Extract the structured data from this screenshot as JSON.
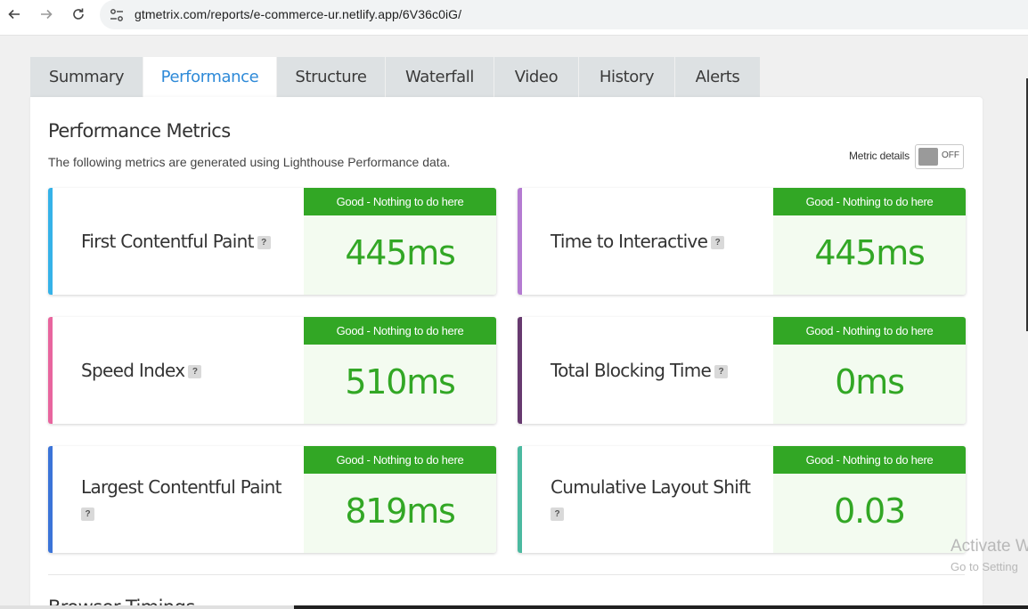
{
  "browser": {
    "url": "gtmetrix.com/reports/e-commerce-ur.netlify.app/6V36c0iG/",
    "back_icon": "arrow-left-icon",
    "forward_icon": "arrow-right-icon",
    "reload_icon": "reload-icon",
    "site_info_icon": "tune-icon"
  },
  "tabs": [
    {
      "label": "Summary",
      "active": false
    },
    {
      "label": "Performance",
      "active": true
    },
    {
      "label": "Structure",
      "active": false
    },
    {
      "label": "Waterfall",
      "active": false
    },
    {
      "label": "Video",
      "active": false
    },
    {
      "label": "History",
      "active": false
    },
    {
      "label": "Alerts",
      "active": false
    }
  ],
  "panel": {
    "title": "Performance Metrics",
    "subtitle": "The following metrics are generated using Lighthouse Performance data.",
    "metric_details_label": "Metric details",
    "toggle_state": "OFF"
  },
  "metrics": [
    {
      "label": "First Contentful Paint",
      "help": "?",
      "banner": "Good - Nothing to do here",
      "value": "445ms",
      "accent": "#35b2e8"
    },
    {
      "label": "Time to Interactive",
      "help": "?",
      "banner": "Good - Nothing to do here",
      "value": "445ms",
      "accent": "#b47bd1"
    },
    {
      "label": "Speed Index",
      "help": "?",
      "banner": "Good - Nothing to do here",
      "value": "510ms",
      "accent": "#e8659e"
    },
    {
      "label": "Total Blocking Time",
      "help": "?",
      "banner": "Good - Nothing to do here",
      "value": "0ms",
      "accent": "#673a6f"
    },
    {
      "label": "Largest Contentful Paint",
      "help": "?",
      "banner": "Good - Nothing to do here",
      "value": "819ms",
      "accent": "#3b74d8"
    },
    {
      "label": "Cumulative Layout Shift",
      "help": "?",
      "banner": "Good - Nothing to do here",
      "value": "0.03",
      "accent": "#4bb9a0"
    }
  ],
  "next_section_heading": "Browser Timings",
  "watermark": {
    "line1": "Activate W",
    "line2": "Go to Setting"
  },
  "colors": {
    "good_green": "#32a725",
    "active_tab": "#2e8ad8",
    "tab_bg": "#dde1e3"
  }
}
